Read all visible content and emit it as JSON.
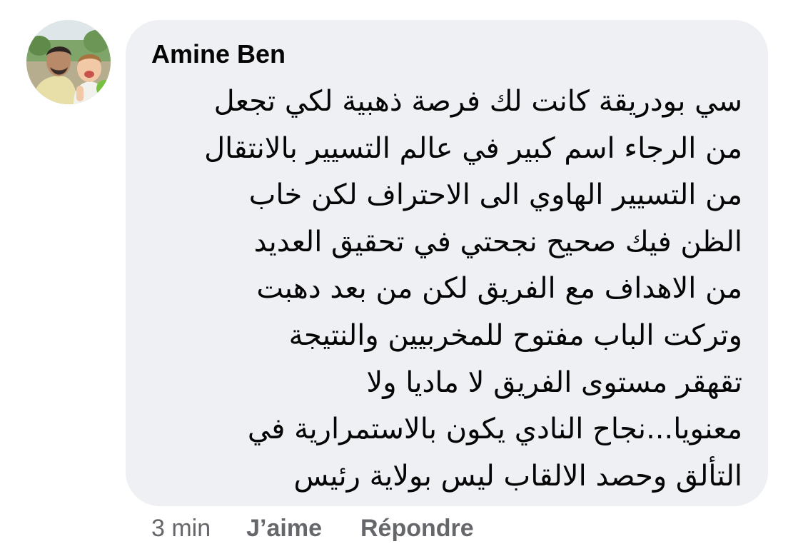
{
  "comment": {
    "author": "Amine Ben",
    "lines": [
      "سي بودريقة كانت لك فرصة ذهبية لكي تجعل",
      "من الرجاء اسم كبير في عالم التسيير بالانتقال",
      "من التسيير الهاوي الى الاحتراف لكن خاب",
      "الظن فيك صحيح نجحتي في تحقيق العديد",
      "من الاهداف مع الفريق لكن من بعد دهبت",
      "وتركت الباب مفتوح للمخربيين والنتيجة",
      "تقهقر مستوى الفريق لا ماديا ولا",
      "معنويا...نجاح النادي يكون بالاستمرارية في",
      "التألق وحصد الالقاب ليس بولاية رئيس"
    ],
    "timestamp": "3 min",
    "like_label": "J’aime",
    "reply_label": "Répondre"
  },
  "colors": {
    "bubble_background": "#eff0f4",
    "text": "#050505",
    "secondary_text": "#65676b"
  }
}
